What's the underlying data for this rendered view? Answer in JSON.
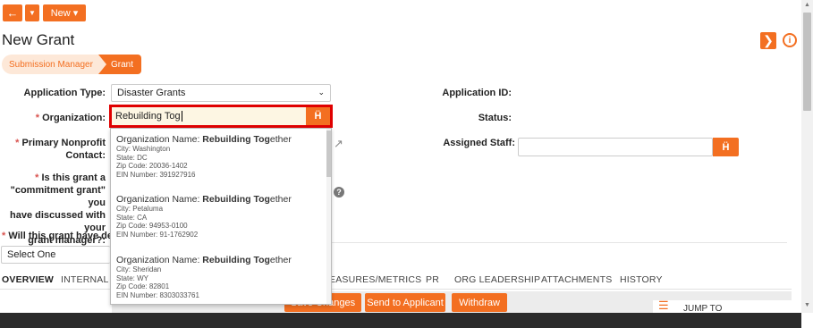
{
  "toolbar": {
    "back_icon": "back-arrow-icon",
    "caret_icon": "caret-down-icon",
    "new_label": "New ▾"
  },
  "page": {
    "title": "New Grant"
  },
  "breadcrumbs": [
    "Submission Manager",
    "Grant"
  ],
  "form": {
    "application_type_label": "Application Type:",
    "application_type_value": "Disaster Grants",
    "organization_label": "Organization:",
    "organization_value": "Rebuilding Tog",
    "primary_contact_label_1": "Primary Nonprofit",
    "primary_contact_label_2": "Contact:",
    "commitment_label_1": "Is this grant a",
    "commitment_label_2": "\"commitment grant\" you",
    "commitment_label_3": "have discussed with your",
    "commitment_label_4": "grant manager?:",
    "demog_label": "Will this grant have demog",
    "select_one": "Select One",
    "application_id_label": "Application ID:",
    "status_label": "Status:",
    "assigned_staff_label": "Assigned Staff:"
  },
  "tabs": [
    "OVERVIEW",
    "INTERNAL",
    "EASURES/METRICS",
    "PR",
    "ORG LEADERSHIP",
    "ATTACHMENTS",
    "HISTORY"
  ],
  "actions": {
    "save": "Save Changes",
    "send": "Send to Applicant",
    "withdraw": "Withdraw",
    "jump": "JUMP TO"
  },
  "dropdown": {
    "prefix": "Organization Name: ",
    "bold": "Rebuilding Tog",
    "rest": "ether",
    "items": [
      {
        "city": "City: Washington",
        "state": "State: DC",
        "zip": "Zip Code: 20036-1402",
        "ein": "EIN Number: 391927916"
      },
      {
        "city": "City: Petaluma",
        "state": "State: CA",
        "zip": "Zip Code: 94953-0100",
        "ein": "EIN Number: 91-1762902"
      },
      {
        "city": "City: Sheridan",
        "state": "State: WY",
        "zip": "Zip Code: 82801",
        "ein": "EIN Number: 8303033761"
      }
    ]
  },
  "colors": {
    "accent": "#f36f21",
    "highlight": "#e00000",
    "input_bg": "#fdf6e3"
  }
}
